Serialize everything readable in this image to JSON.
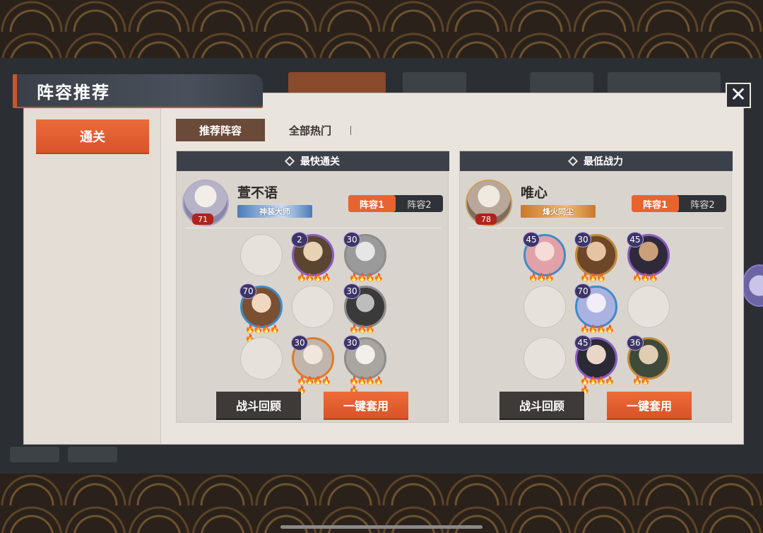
{
  "dialog": {
    "title": "阵容推荐",
    "close_icon": "close-icon"
  },
  "sidebar": {
    "items": [
      {
        "label": "通关",
        "active": true
      }
    ]
  },
  "tabs": [
    {
      "label": "推荐阵容",
      "active": true
    },
    {
      "label": "全部热门",
      "active": false
    }
  ],
  "panels": [
    {
      "header": "最快通关",
      "leader": {
        "name": "萱不语",
        "level": "71",
        "title": "神装大师"
      },
      "lineup_tabs": [
        "阵容1",
        "阵容2"
      ],
      "active_lineup": "阵容1",
      "heroes": [
        {
          "slot": "r1c1",
          "empty": true
        },
        {
          "slot": "r1c2",
          "level": "2"
        },
        {
          "slot": "r1c3",
          "level": "30"
        },
        {
          "slot": "r2c1",
          "level": "70"
        },
        {
          "slot": "r2c2",
          "empty": true
        },
        {
          "slot": "r2c3",
          "level": "30"
        },
        {
          "slot": "r3c1",
          "empty": true
        },
        {
          "slot": "r3c2",
          "level": "30"
        },
        {
          "slot": "r3c3",
          "level": "30"
        }
      ],
      "review_label": "战斗回顾",
      "apply_label": "一键套用"
    },
    {
      "header": "最低战力",
      "leader": {
        "name": "唯心",
        "level": "78",
        "title": "烽火同尘"
      },
      "lineup_tabs": [
        "阵容1",
        "阵容2"
      ],
      "active_lineup": "阵容1",
      "heroes": [
        {
          "slot": "r1c1",
          "level": "45"
        },
        {
          "slot": "r1c2",
          "level": "30"
        },
        {
          "slot": "r1c3",
          "level": "45"
        },
        {
          "slot": "r2c1",
          "empty": true
        },
        {
          "slot": "r2c2",
          "level": "70"
        },
        {
          "slot": "r2c3",
          "empty": true
        },
        {
          "slot": "r3c1",
          "empty": true
        },
        {
          "slot": "r3c2",
          "level": "45"
        },
        {
          "slot": "r3c3",
          "level": "36"
        }
      ],
      "review_label": "战斗回顾",
      "apply_label": "一键套用"
    }
  ]
}
